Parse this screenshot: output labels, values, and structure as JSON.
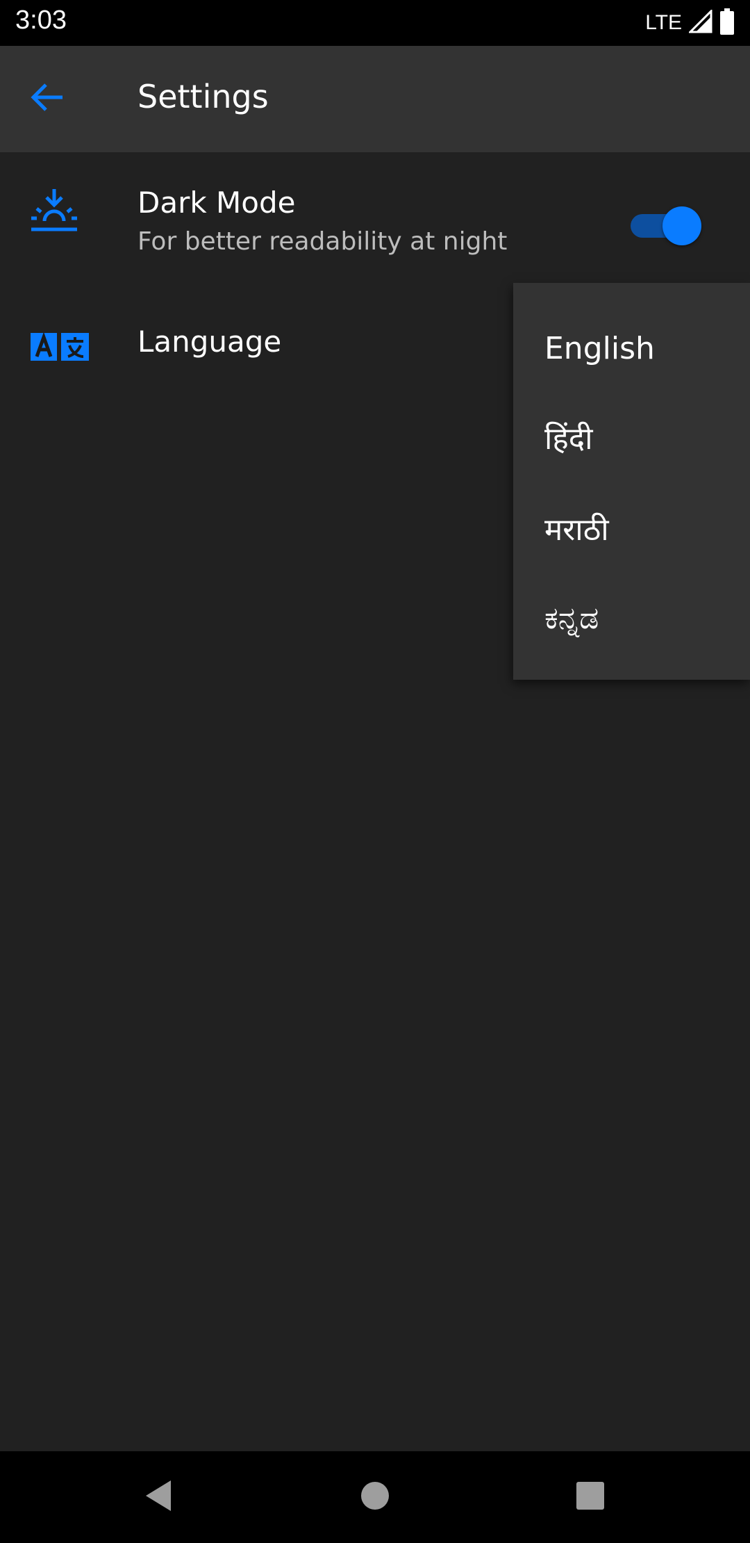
{
  "status_bar": {
    "time": "3:03",
    "network": "LTE",
    "icons": [
      "signal-icon",
      "battery-icon"
    ]
  },
  "app_bar": {
    "title": "Settings",
    "back_icon": "arrow-back-icon"
  },
  "settings": {
    "dark_mode": {
      "icon": "sunrise-icon",
      "title": "Dark Mode",
      "subtitle": "For better readability at night",
      "enabled": true
    },
    "language": {
      "icon": "translate-icon",
      "title": "Language"
    }
  },
  "language_menu": {
    "options": [
      "English",
      "हिंदी",
      "मराठी",
      "ಕನ್ನಡ"
    ]
  },
  "nav_bar": {
    "icons": [
      "back-triangle-icon",
      "home-circle-icon",
      "recents-square-icon"
    ]
  },
  "colors": {
    "accent": "#0a7cff",
    "background": "#212121",
    "app_bar": "#333333",
    "menu": "#333333"
  }
}
